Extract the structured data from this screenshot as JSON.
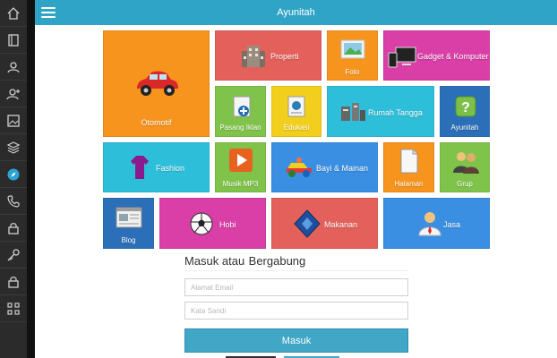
{
  "header": {
    "title": "Ayunitah"
  },
  "sidebar": {
    "items": [
      {
        "icon": "home-icon"
      },
      {
        "icon": "book-icon"
      },
      {
        "icon": "users-icon"
      },
      {
        "icon": "user-add-icon"
      },
      {
        "icon": "image-icon"
      },
      {
        "icon": "layers-icon"
      },
      {
        "icon": "compass-icon"
      },
      {
        "icon": "phone-icon"
      },
      {
        "icon": "lock-icon"
      },
      {
        "icon": "key-icon"
      },
      {
        "icon": "lock-icon"
      },
      {
        "icon": "grid-icon"
      }
    ]
  },
  "tiles": {
    "otomotif": "Otomotif",
    "properti": "Properti",
    "foto": "Foto",
    "gadget": "Gadget & Komputer",
    "pasang_iklan": "Pasang Iklan",
    "edukasi": "Edukasi",
    "rumah_tangga": "Rumah Tangga",
    "ayunitah": "Ayunitah",
    "fashion": "Fashion",
    "musik": "Musik MP3",
    "bayi": "Bayi & Mainan",
    "halaman": "Halaman",
    "grup": "Grup",
    "blog": "Blog",
    "hobi": "Hobi",
    "makanan": "Makanan",
    "jasa": "Jasa"
  },
  "colors": {
    "header": "#30a4c6",
    "orange": "#f7941d",
    "salmon": "#e4605a",
    "magenta": "#d93fa6",
    "green": "#80c34b",
    "yellow": "#f2cf1c",
    "cyan": "#2dbfd9",
    "blue": "#3a8fe3",
    "darkblue": "#2b6fb8"
  },
  "auth": {
    "title": "Masuk atau",
    "register_link": "Bergabung",
    "email_placeholder": "Alamat Email",
    "password_placeholder": "Kata Sandi",
    "submit_label": "Masuk"
  }
}
